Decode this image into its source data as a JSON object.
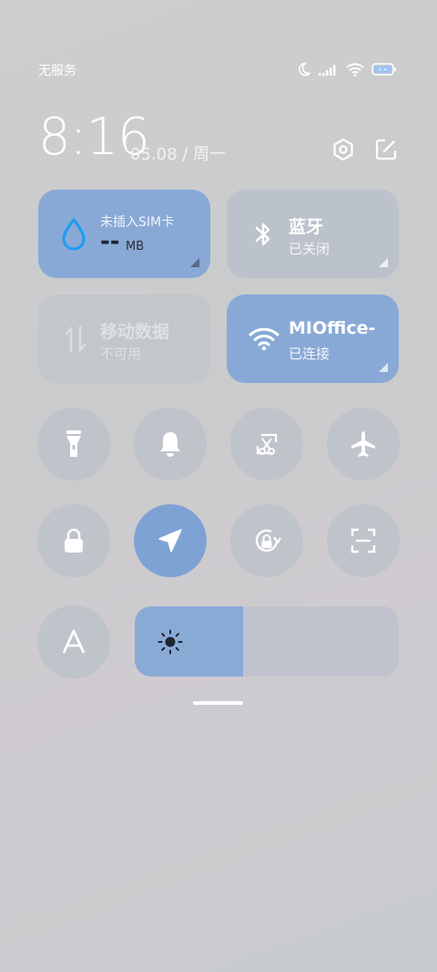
{
  "status_bar": {
    "carrier": "无服务",
    "icons": [
      "moon-icon",
      "signal-icon",
      "wifi-icon",
      "battery-icon"
    ]
  },
  "header": {
    "time": "8:16",
    "date": "05.08 / 周一",
    "icons": [
      "settings-icon",
      "edit-icon"
    ]
  },
  "tiles": {
    "data_usage": {
      "label": "未插入SIM卡",
      "value": "--",
      "unit": "MB"
    },
    "bluetooth": {
      "title": "蓝牙",
      "status": "已关闭"
    },
    "mobile_data": {
      "title": "移动数据",
      "status": "不可用"
    },
    "wifi": {
      "title": "MIOffice-",
      "status": "已连接"
    }
  },
  "toggles": [
    {
      "icon": "flashlight-icon",
      "active": false
    },
    {
      "icon": "bell-icon",
      "active": false
    },
    {
      "icon": "screenshot-icon",
      "active": false
    },
    {
      "icon": "airplane-icon",
      "active": false
    },
    {
      "icon": "lock-icon",
      "active": false
    },
    {
      "icon": "location-icon",
      "active": true
    },
    {
      "icon": "rotation-lock-icon",
      "active": false
    },
    {
      "icon": "scan-icon",
      "active": false
    },
    {
      "icon": "auto-brightness-icon",
      "active": false
    }
  ],
  "brightness": {
    "level": 0.41,
    "icon": "sun-icon"
  },
  "colors": {
    "accent": "#88a9d6",
    "tile_inactive": "#bcc2cc",
    "data_icon": "#1e9bf0"
  }
}
